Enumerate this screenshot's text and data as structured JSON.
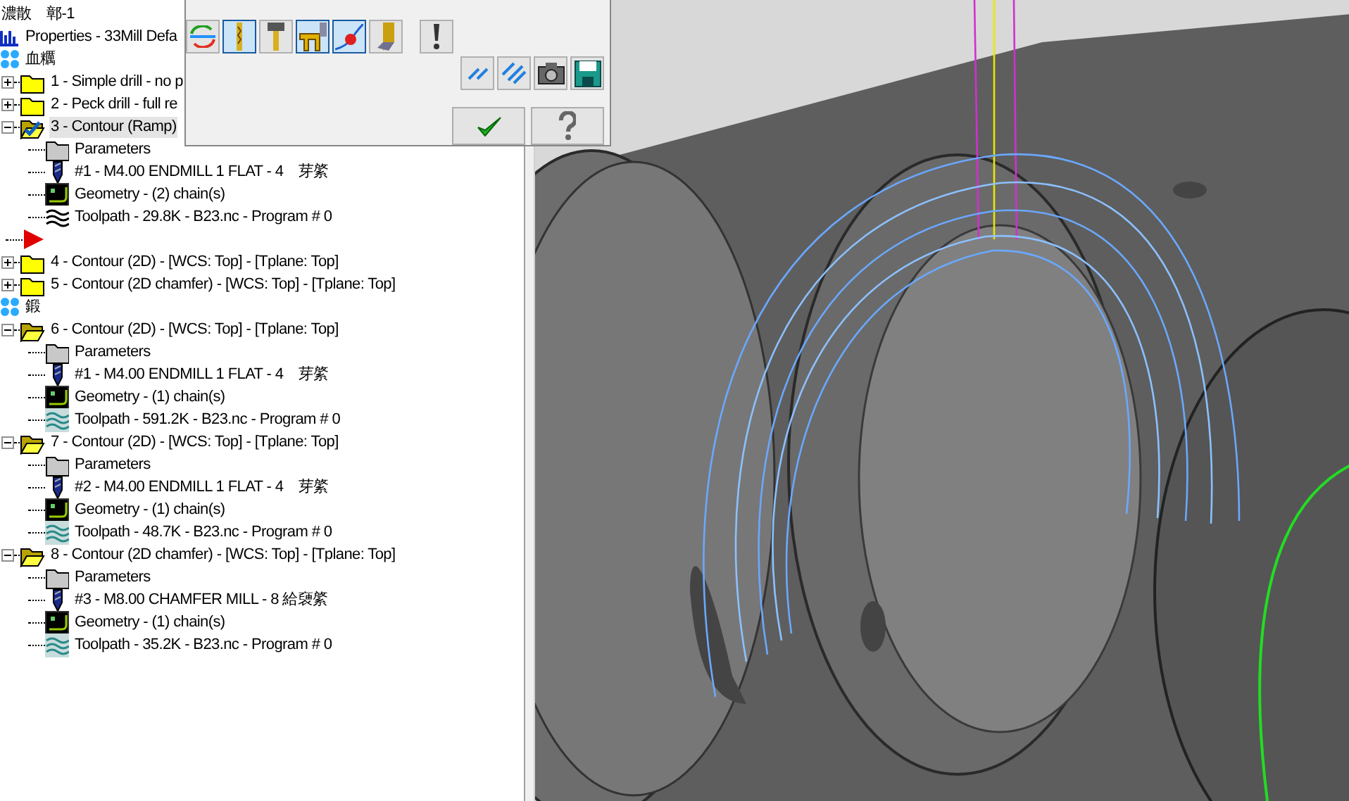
{
  "tree": {
    "header": "濃散　鄣-1",
    "properties": {
      "label": "Properties - 33Mill Defa"
    },
    "items": [
      {
        "kind": "group",
        "label": "血糲"
      },
      {
        "kind": "operation",
        "label": "1 - Simple drill - no p",
        "expanded": false,
        "selected": false,
        "checked": false
      },
      {
        "kind": "operation",
        "label": "2 - Peck drill - full re",
        "expanded": false,
        "selected": false,
        "checked": false
      },
      {
        "kind": "operation",
        "label": "3 - Contour (Ramp)",
        "expanded": true,
        "selected": true,
        "checked": true,
        "children": [
          {
            "kind": "parameters",
            "label": "Parameters"
          },
          {
            "kind": "tool",
            "label": "#1 - M4.00 ENDMILL 1 FLAT - 4　芽綮"
          },
          {
            "kind": "geometry",
            "label": "Geometry - (2) chain(s)"
          },
          {
            "kind": "toolpath",
            "label": "Toolpath - 29.8K - B23.nc - Program # 0",
            "dirty": true
          }
        ]
      },
      {
        "kind": "insert-marker"
      },
      {
        "kind": "operation",
        "label": "4 - Contour (2D) - [WCS: Top] - [Tplane: Top]",
        "expanded": false,
        "selected": false,
        "checked": false
      },
      {
        "kind": "operation",
        "label": "5 - Contour (2D chamfer) - [WCS: Top] - [Tplane: Top]",
        "expanded": false,
        "selected": false,
        "checked": false
      },
      {
        "kind": "group",
        "label": "鍛"
      },
      {
        "kind": "operation",
        "label": "6 - Contour (2D) - [WCS: Top] - [Tplane: Top]",
        "expanded": true,
        "selected": false,
        "checked": false,
        "children": [
          {
            "kind": "parameters",
            "label": "Parameters"
          },
          {
            "kind": "tool",
            "label": "#1 - M4.00 ENDMILL 1 FLAT - 4　芽綮"
          },
          {
            "kind": "geometry",
            "label": "Geometry - (1) chain(s)"
          },
          {
            "kind": "toolpath",
            "label": "Toolpath - 591.2K - B23.nc - Program # 0",
            "dirty": false
          }
        ]
      },
      {
        "kind": "operation",
        "label": "7 - Contour (2D) - [WCS: Top] - [Tplane: Top]",
        "expanded": true,
        "selected": false,
        "checked": false,
        "children": [
          {
            "kind": "parameters",
            "label": "Parameters"
          },
          {
            "kind": "tool",
            "label": "#2 - M4.00 ENDMILL 1 FLAT - 4　芽綮"
          },
          {
            "kind": "geometry",
            "label": "Geometry - (1) chain(s)"
          },
          {
            "kind": "toolpath",
            "label": "Toolpath - 48.7K - B23.nc - Program # 0",
            "dirty": false
          }
        ]
      },
      {
        "kind": "operation",
        "label": "8 - Contour (2D chamfer) - [WCS: Top] - [Tplane: Top]",
        "expanded": true,
        "selected": false,
        "checked": false,
        "children": [
          {
            "kind": "parameters",
            "label": "Parameters"
          },
          {
            "kind": "tool",
            "label": "#3 - M8.00 CHAMFER MILL - 8 給褏綮"
          },
          {
            "kind": "geometry",
            "label": "Geometry - (1) chain(s)"
          },
          {
            "kind": "toolpath",
            "label": "Toolpath - 35.2K - B23.nc - Program # 0",
            "dirty": false
          }
        ]
      }
    ]
  },
  "dialog": {
    "toggles": [
      {
        "kind": "refresh",
        "pressed": false
      },
      {
        "kind": "tool",
        "pressed": true
      },
      {
        "kind": "holder",
        "pressed": false
      },
      {
        "kind": "fixture",
        "pressed": true
      },
      {
        "kind": "point",
        "pressed": true
      },
      {
        "kind": "stock",
        "pressed": false
      },
      {
        "kind": "alert",
        "pressed": false
      }
    ],
    "tools": [
      {
        "kind": "hatch"
      },
      {
        "kind": "hatch-dense"
      },
      {
        "kind": "camera"
      },
      {
        "kind": "save"
      }
    ],
    "buttons": [
      {
        "kind": "ok"
      },
      {
        "kind": "help"
      }
    ]
  }
}
